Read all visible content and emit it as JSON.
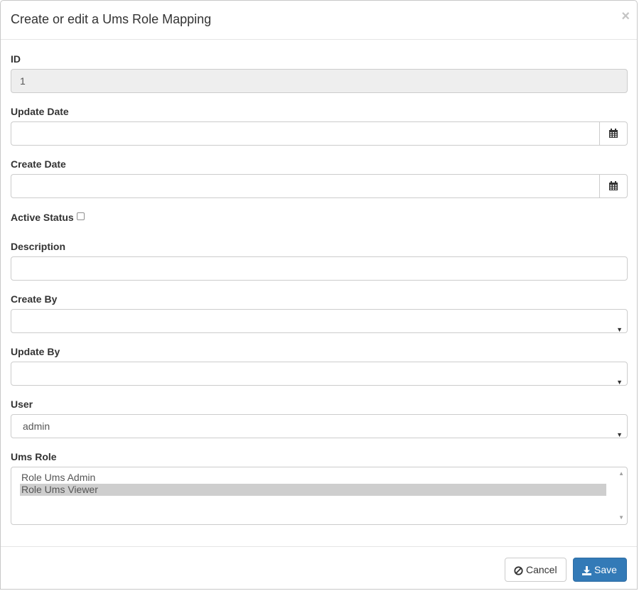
{
  "dialog": {
    "title": "Create or edit a Ums Role Mapping",
    "close_label": "×"
  },
  "fields": {
    "id": {
      "label": "ID",
      "value": "1"
    },
    "update_date": {
      "label": "Update Date",
      "value": "",
      "button_icon": "calendar-icon"
    },
    "create_date": {
      "label": "Create Date",
      "value": "",
      "button_icon": "calendar-icon"
    },
    "active_status": {
      "label": "Active Status",
      "checked": false
    },
    "description": {
      "label": "Description",
      "value": ""
    },
    "create_by": {
      "label": "Create By",
      "selected": ""
    },
    "update_by": {
      "label": "Update By",
      "selected": ""
    },
    "user": {
      "label": "User",
      "selected": "admin"
    },
    "ums_role": {
      "label": "Ums Role",
      "options": [
        {
          "label": "Role Ums Admin",
          "selected": false
        },
        {
          "label": "Role Ums Viewer",
          "selected": true
        }
      ]
    }
  },
  "footer": {
    "cancel_label": "Cancel",
    "cancel_icon": "ban-icon",
    "save_label": "Save",
    "save_icon": "download-icon"
  },
  "colors": {
    "primary": "#337ab7",
    "readonly_bg": "#eeeeee",
    "selected_option_bg": "#cecece"
  }
}
